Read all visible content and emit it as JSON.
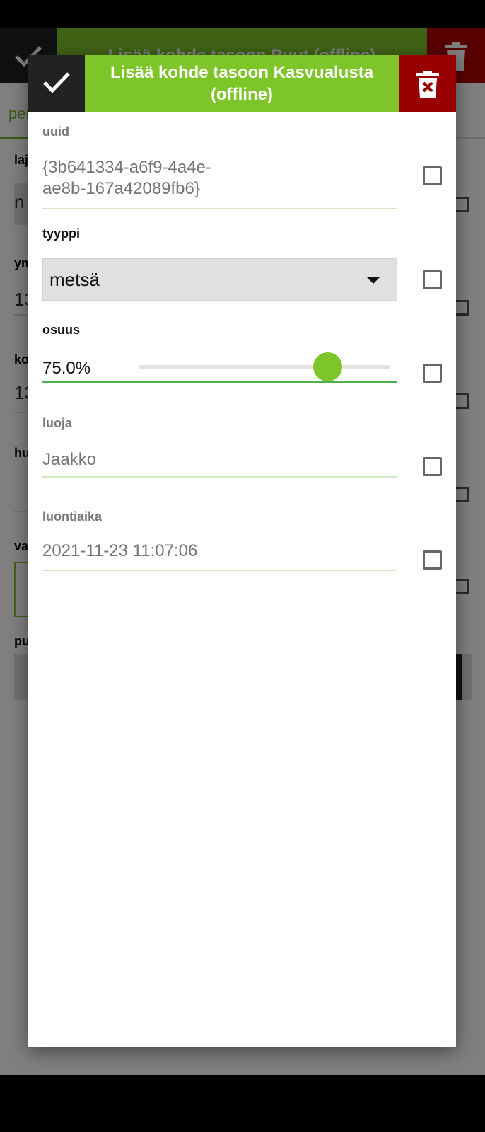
{
  "background": {
    "title": "Lisää kohde tasoon Puut (offline)",
    "tab_label": "perus",
    "field_labels": [
      "laji",
      "ym",
      "ko",
      "hu",
      "va",
      "pu"
    ],
    "field_values": [
      "n",
      "13",
      "13"
    ]
  },
  "dialog": {
    "title": "Lisää kohde tasoon Kasvualusta (offline)",
    "accept_icon": "check-icon",
    "delete_icon": "trash-delete-icon",
    "fields": {
      "uuid": {
        "label": "uuid",
        "value": "{3b641334-a6f9-4a4e-ae8b-167a42089fb6}"
      },
      "tyyppi": {
        "label": "tyyppi",
        "value": "metsä"
      },
      "osuus": {
        "label": "osuus",
        "value_text": "75.0%",
        "level": 0.75
      },
      "luoja": {
        "label": "luoja",
        "value": "Jaakko"
      },
      "luontiaika": {
        "label": "luontiaika",
        "value": "2021-11-23 11:07:06"
      }
    }
  },
  "colors": {
    "accent_green": "#7ec52a",
    "delete_red": "#990000",
    "header_dark": "#222222",
    "line_green": "#4cb050"
  }
}
